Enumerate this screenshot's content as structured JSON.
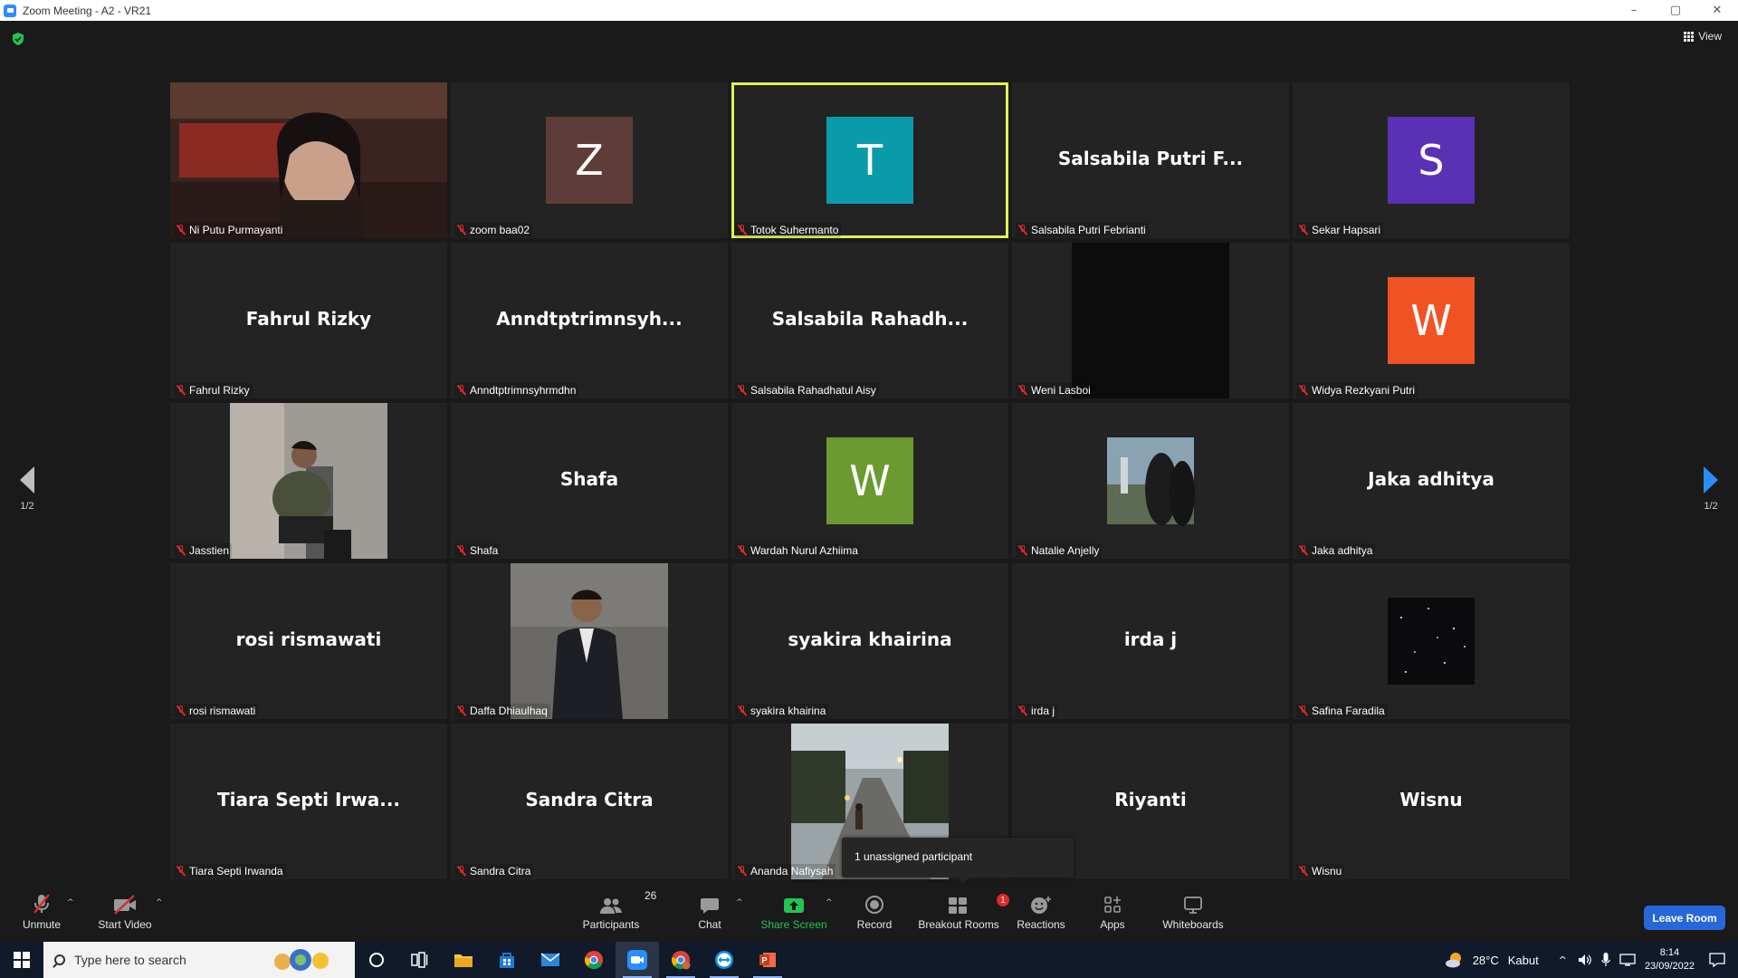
{
  "window": {
    "title": "Zoom Meeting - A2 - VR21",
    "controls": [
      "–",
      "▢",
      "✕"
    ]
  },
  "meeting": {
    "view_label": "View",
    "page_indicator_left": "1/2",
    "page_indicator_right": "1/2",
    "active_speaker": "Totok Suhermanto",
    "tooltip": "1 unassigned participant"
  },
  "participants": [
    {
      "name": "Ni Putu Purmayanti",
      "type": "video",
      "video": "webcam-dark-room"
    },
    {
      "name": "zoom baa02",
      "type": "avatar",
      "initial": "Z",
      "color": "#5e3d38"
    },
    {
      "name": "Totok Suhermanto",
      "type": "avatar",
      "initial": "T",
      "color": "#0a9bab"
    },
    {
      "name": "Salsabila Putri Febrianti",
      "type": "text",
      "display": "Salsabila Putri F..."
    },
    {
      "name": "Sekar Hapsari",
      "type": "avatar",
      "initial": "S",
      "color": "#5a30b5"
    },
    {
      "name": "Fahrul Rizky",
      "type": "text",
      "display": "Fahrul Rizky"
    },
    {
      "name": "Anndtptrimnsyhrmdhn",
      "type": "text",
      "display": "Anndtptrimnsyh..."
    },
    {
      "name": "Salsabila Rahadhatul Aisy",
      "type": "text",
      "display": "Salsabila  Rahadh..."
    },
    {
      "name": "Weni Lasboi",
      "type": "video",
      "video": "black-feed"
    },
    {
      "name": "Widya Rezkyani Putri",
      "type": "avatar",
      "initial": "W",
      "color": "#f05323"
    },
    {
      "name": "Jasstien",
      "type": "video",
      "video": "photo-man-camo-shirt"
    },
    {
      "name": "Shafa",
      "type": "text",
      "display": "Shafa"
    },
    {
      "name": "Wardah Nurul Azhiima",
      "type": "avatar",
      "initial": "W",
      "color": "#6a9a30"
    },
    {
      "name": "Natalie Anjelly",
      "type": "video",
      "video": "photo-window-silhouette"
    },
    {
      "name": "Jaka adhitya",
      "type": "text",
      "display": "Jaka adhitya"
    },
    {
      "name": "rosi rismawati",
      "type": "text",
      "display": "rosi rismawati"
    },
    {
      "name": "Daffa Dhiaulhaq",
      "type": "video",
      "video": "photo-man-suit"
    },
    {
      "name": "syakira khairina",
      "type": "text",
      "display": "syakira khairina"
    },
    {
      "name": "irda j",
      "type": "text",
      "display": "irda j"
    },
    {
      "name": "Safina Faradila",
      "type": "video",
      "video": "photo-starfield"
    },
    {
      "name": "Tiara Septi Irwanda",
      "type": "text",
      "display": "Tiara Septi Irwa..."
    },
    {
      "name": "Sandra Citra",
      "type": "text",
      "display": "Sandra Citra"
    },
    {
      "name": "Ananda Nafiysah",
      "type": "video",
      "video": "photo-evening-street"
    },
    {
      "name": "Riyanti",
      "type": "text",
      "display": "Riyanti"
    },
    {
      "name": "Wisnu",
      "type": "text",
      "display": "Wisnu"
    }
  ],
  "toolbar": {
    "unmute": "Unmute",
    "start_video": "Start Video",
    "participants": "Participants",
    "participants_count": "26",
    "chat": "Chat",
    "share_screen": "Share Screen",
    "record": "Record",
    "breakout_rooms": "Breakout Rooms",
    "breakout_badge": "1",
    "reactions": "Reactions",
    "apps": "Apps",
    "whiteboards": "Whiteboards",
    "leave": "Leave Room"
  },
  "taskbar": {
    "search_placeholder": "Type here to search",
    "weather_temp": "28°C",
    "weather_desc": "Kabut",
    "time": "8:14",
    "date": "23/09/2022"
  },
  "colors": {
    "accent_blue": "#2d8cff",
    "active_speaker_border": "#e2f05a",
    "muted_red": "#e02828",
    "share_green": "#23c552",
    "leave_blue": "#2668d9"
  }
}
